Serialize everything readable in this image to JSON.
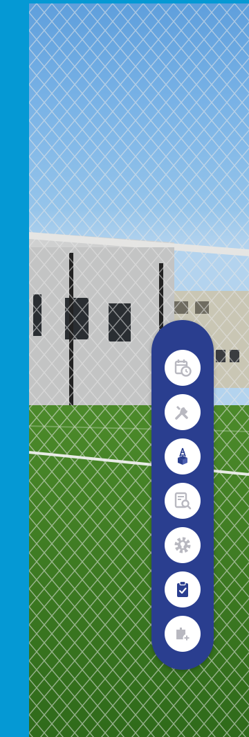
{
  "colors": {
    "brand_blue": "#0599d4",
    "dock_navy": "#2a3e8f",
    "button_white": "#ffffff",
    "icon_gray": "#b8b8c0",
    "icon_active": "#2a3e8f"
  },
  "dock": {
    "items": [
      {
        "icon": "calendar-clock-icon",
        "active": false
      },
      {
        "icon": "tools-icon",
        "active": false
      },
      {
        "icon": "tower-box-icon",
        "active": true
      },
      {
        "icon": "document-search-icon",
        "active": false
      },
      {
        "icon": "gear-lightbulb-icon",
        "active": false
      },
      {
        "icon": "clipboard-check-icon",
        "active": true
      },
      {
        "icon": "add-module-icon",
        "active": false
      }
    ]
  }
}
